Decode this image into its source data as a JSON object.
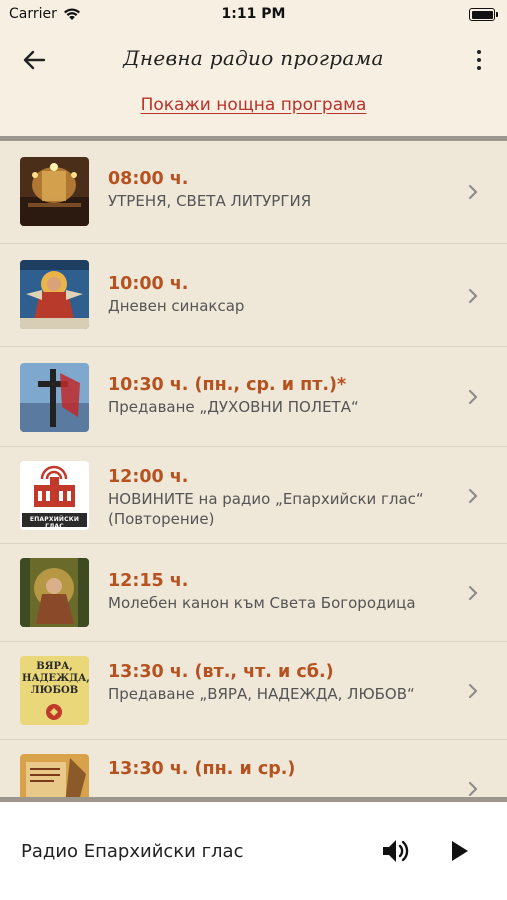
{
  "status_bar": {
    "carrier": "Carrier",
    "time": "1:11 PM",
    "wifi_icon": "wifi-icon",
    "battery_level": 1.0
  },
  "nav": {
    "title": "Дневна радио програма",
    "back_icon": "arrow-left-icon",
    "more_icon": "more-vertical-icon",
    "night_link": "Покажи нощна програма"
  },
  "schedule": [
    {
      "time": "08:00 ч.",
      "desc": "УТРЕНЯ, СВЕТА ЛИТУРГИЯ",
      "thumb": "church-interior-image"
    },
    {
      "time": "10:00 ч.",
      "desc": "Дневен синаксар",
      "thumb": "icon-painting-image"
    },
    {
      "time": "10:30 ч. (пн., ср. и пт.)*",
      "desc": "Предаване „ДУХОВНИ ПОЛЕТА“",
      "thumb": "cross-sky-image"
    },
    {
      "time": "12:00 ч.",
      "desc": "НОВИНИТЕ на радио „Епархийски глас“ (Повторение)",
      "thumb": "radio-logo-image",
      "logo_text": "ЕПАРХИЙСКИ ГЛАС"
    },
    {
      "time": "12:15 ч.",
      "desc": "Молебен канон към Света Богородица",
      "thumb": "theotokos-icon-image"
    },
    {
      "time": "13:30 ч. (вт., чт. и сб.)",
      "desc": "Предаване „ВЯРА, НАДЕЖДА, ЛЮБОВ“",
      "thumb": "faith-hope-love-image",
      "logo_text": "ВЯРА, НАДЕЖДА, ЛЮБОВ"
    },
    {
      "time": "13:30 ч. (пн. и ср.)",
      "desc": "",
      "thumb": "manuscript-image"
    }
  ],
  "player": {
    "station": "Радио Епархийски глас",
    "volume_icon": "volume-icon",
    "play_icon": "play-icon"
  },
  "colors": {
    "time_text": "#b5521f",
    "link": "#b8322c",
    "background": "#efe7d8"
  }
}
